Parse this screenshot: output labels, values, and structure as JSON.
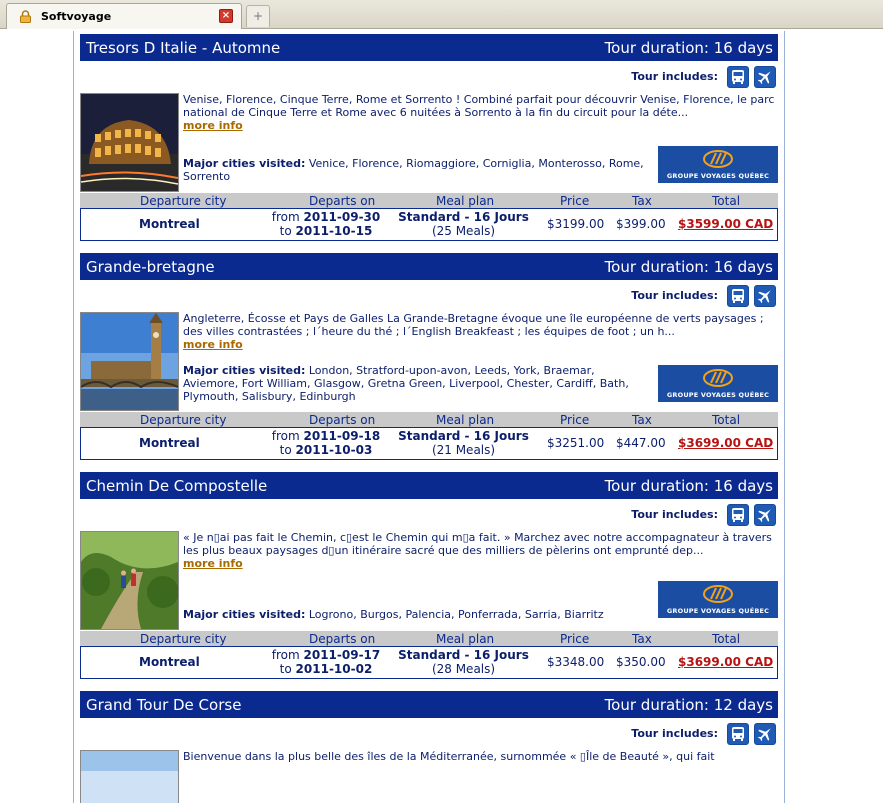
{
  "browser": {
    "tab_title": "Softvoyage",
    "new_tab_symbol": "+"
  },
  "tours": [
    {
      "name": "Tresors D Italie - Automne",
      "duration": "Tour duration: 16 days",
      "includes_label": "Tour includes:",
      "description": "Venise, Florence, Cinque Terre, Rome et Sorrento ! Combiné parfait pour découvrir Venise, Florence, le parc national de Cinque Terre et Rome avec 6 nuitées à Sorrento à la fin du circuit pour la déte...",
      "more_info": "more info",
      "cities_label": "Major cities visited:",
      "cities": "Venice, Florence, Riomaggiore, Corniglia, Monterosso, Rome, Sorrento",
      "operator_logo_text": "GROUPE VOYAGES QUÉBEC",
      "table": {
        "headers": [
          "Departure city",
          "Departs on",
          "Meal plan",
          "Price",
          "Tax",
          "Total"
        ],
        "city": "Montreal",
        "from_label": "from",
        "from_date": "2011-09-30",
        "to_label": "to",
        "to_date": "2011-10-15",
        "meal_plan": "Standard - 16 Jours",
        "meals": "(25 Meals)",
        "price": "$3199.00",
        "tax": "$399.00",
        "total": "$3599.00 CAD"
      }
    },
    {
      "name": "Grande-bretagne",
      "duration": "Tour duration: 16 days",
      "includes_label": "Tour includes:",
      "description": "Angleterre, Écosse et Pays de Galles La Grande-Bretagne évoque une île européenne de verts paysages ; des villes contrastées ; l´heure du thé ; l´English Breakfeast ; les équipes de foot ; un h...",
      "more_info": "more info",
      "cities_label": "Major cities visited:",
      "cities": "London, Stratford-upon-avon, Leeds, York, Braemar, Aviemore, Fort William, Glasgow, Gretna Green, Liverpool, Chester, Cardiff, Bath, Plymouth, Salisbury, Edinburgh",
      "operator_logo_text": "GROUPE VOYAGES QUÉBEC",
      "table": {
        "headers": [
          "Departure city",
          "Departs on",
          "Meal plan",
          "Price",
          "Tax",
          "Total"
        ],
        "city": "Montreal",
        "from_label": "from",
        "from_date": "2011-09-18",
        "to_label": "to",
        "to_date": "2011-10-03",
        "meal_plan": "Standard - 16 Jours",
        "meals": "(21 Meals)",
        "price": "$3251.00",
        "tax": "$447.00",
        "total": "$3699.00 CAD"
      }
    },
    {
      "name": "Chemin De Compostelle",
      "duration": "Tour duration: 16 days",
      "includes_label": "Tour includes:",
      "description": "« Je n▯ai pas fait le Chemin, c▯est le Chemin qui m▯a fait. » Marchez avec notre accompagnateur à travers les plus beaux paysages d▯un itinéraire sacré que des milliers de pèlerins ont emprunté dep...",
      "more_info": "more info",
      "cities_label": "Major cities visited:",
      "cities": "Logrono, Burgos, Palencia, Ponferrada, Sarria, Biarritz",
      "operator_logo_text": "GROUPE VOYAGES QUÉBEC",
      "table": {
        "headers": [
          "Departure city",
          "Departs on",
          "Meal plan",
          "Price",
          "Tax",
          "Total"
        ],
        "city": "Montreal",
        "from_label": "from",
        "from_date": "2011-09-17",
        "to_label": "to",
        "to_date": "2011-10-02",
        "meal_plan": "Standard - 16 Jours",
        "meals": "(28 Meals)",
        "price": "$3348.00",
        "tax": "$350.00",
        "total": "$3699.00 CAD"
      }
    },
    {
      "name": "Grand Tour De Corse",
      "duration": "Tour duration: 12 days",
      "includes_label": "Tour includes:",
      "description": "Bienvenue dans la plus belle des îles de la Méditerranée, surnommée « ▯Île de Beauté », qui fait"
    }
  ]
}
